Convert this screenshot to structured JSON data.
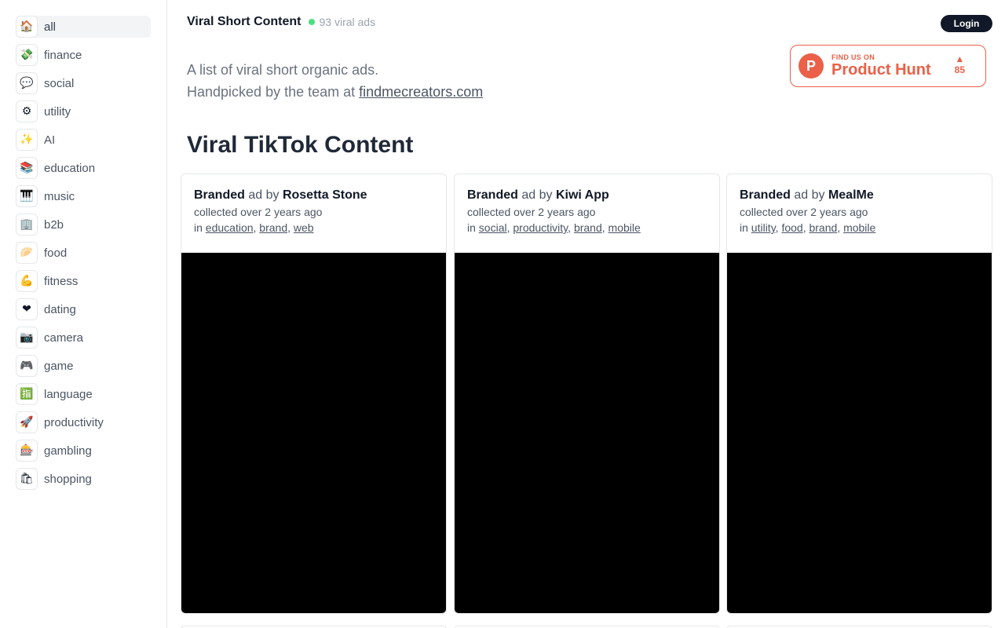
{
  "sidebar": {
    "items": [
      {
        "label": "all",
        "icon": "🏠",
        "icon_name": "house-icon"
      },
      {
        "label": "finance",
        "icon": "💸",
        "icon_name": "money-icon"
      },
      {
        "label": "social",
        "icon": "💬",
        "icon_name": "speech-bubble-icon"
      },
      {
        "label": "utility",
        "icon": "⚙",
        "icon_name": "gear-icon"
      },
      {
        "label": "AI",
        "icon": "✨",
        "icon_name": "sparkles-icon"
      },
      {
        "label": "education",
        "icon": "📚",
        "icon_name": "books-icon"
      },
      {
        "label": "music",
        "icon": "🎹",
        "icon_name": "piano-icon"
      },
      {
        "label": "b2b",
        "icon": "🏢",
        "icon_name": "office-building-icon"
      },
      {
        "label": "food",
        "icon": "🥟",
        "icon_name": "food-icon"
      },
      {
        "label": "fitness",
        "icon": "💪",
        "icon_name": "biceps-icon"
      },
      {
        "label": "dating",
        "icon": "❤",
        "icon_name": "heart-icon"
      },
      {
        "label": "camera",
        "icon": "📷",
        "icon_name": "camera-icon"
      },
      {
        "label": "game",
        "icon": "🎮",
        "icon_name": "gamepad-icon"
      },
      {
        "label": "language",
        "icon": "🈯",
        "icon_name": "language-icon"
      },
      {
        "label": "productivity",
        "icon": "🚀",
        "icon_name": "rocket-icon"
      },
      {
        "label": "gambling",
        "icon": "🎰",
        "icon_name": "slot-machine-icon"
      },
      {
        "label": "shopping",
        "icon": "🛍",
        "icon_name": "shopping-bags-icon"
      }
    ]
  },
  "header": {
    "title": "Viral Short Content",
    "count": "93 viral ads",
    "login_label": "Login"
  },
  "intro": {
    "line1": "A list of viral short organic ads.",
    "line2_prefix": "Handpicked by the team at ",
    "link": "findmecreators.com"
  },
  "product_hunt": {
    "small": "FIND US ON",
    "big": "Product Hunt",
    "logo": "P",
    "arrow": "▲",
    "votes": "85"
  },
  "section": {
    "title": "Viral TikTok Content"
  },
  "cards": [
    {
      "type": "Branded",
      "by": " ad by ",
      "brand": "Rosetta Stone",
      "collected": "collected over 2 years ago",
      "in": "in ",
      "tags": [
        "education",
        "brand",
        "web"
      ]
    },
    {
      "type": "Branded",
      "by": " ad by ",
      "brand": "Kiwi App",
      "collected": "collected over 2 years ago",
      "in": "in ",
      "tags": [
        "social",
        "productivity",
        "brand",
        "mobile"
      ]
    },
    {
      "type": "Branded",
      "by": " ad by ",
      "brand": "MealMe",
      "collected": "collected over 2 years ago",
      "in": "in ",
      "tags": [
        "utility",
        "food",
        "brand",
        "mobile"
      ]
    }
  ],
  "colors": {
    "accent": "#ea6048",
    "status_dot": "#4ade80",
    "login_bg": "#111827"
  }
}
